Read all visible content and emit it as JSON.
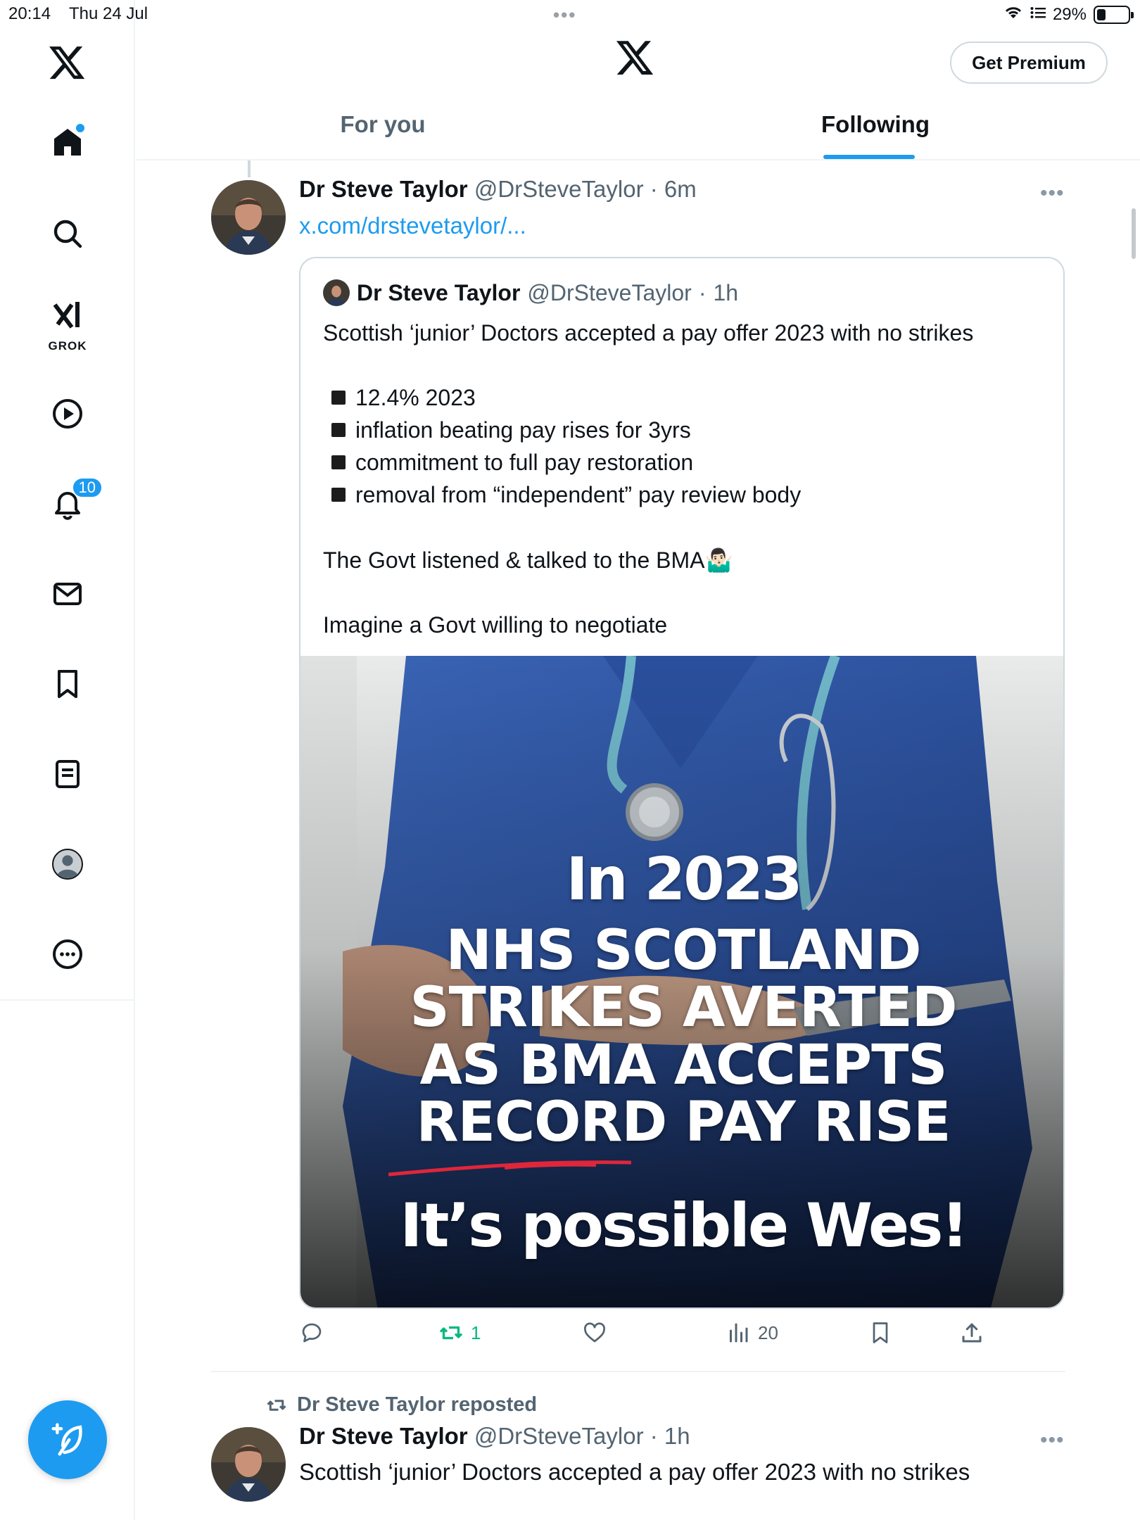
{
  "status_bar": {
    "time": "20:14",
    "date": "Thu 24 Jul",
    "battery": "29%",
    "battery_level": 0.29
  },
  "nav": {
    "notifications_badge": "10",
    "grok_label": "GROK",
    "items": [
      "home-icon",
      "search-icon",
      "grok-icon",
      "video-icon",
      "bell-icon",
      "mail-icon",
      "bookmark-icon",
      "list-icon",
      "profile-icon",
      "more-icon"
    ]
  },
  "header": {
    "premium_label": "Get Premium",
    "tabs": [
      {
        "label": "For you",
        "active": false
      },
      {
        "label": "Following",
        "active": true
      }
    ]
  },
  "tweet": {
    "author": "Dr Steve Taylor",
    "handle": "@DrSteveTaylor",
    "sep": "·",
    "time": "6m",
    "link": "x.com/drstevetaylor/...",
    "quote": {
      "author": "Dr Steve Taylor",
      "handle": "@DrSteveTaylor",
      "time": "1h",
      "line1": "Scottish ‘junior’ Doctors accepted a pay offer 2023 with no strikes",
      "bullets": [
        "12.4% 2023",
        "inflation beating pay rises for 3yrs",
        "commitment to full pay restoration",
        "removal from “independent” pay review body"
      ],
      "line2": "The Govt listened & talked to the BMA🤷🏻‍♂️",
      "line3": "Imagine a Govt willing to negotiate",
      "image_text": {
        "l1": "In 2023",
        "l2": "NHS SCOTLAND",
        "l3": "STRIKES AVERTED",
        "l4": "AS BMA ACCEPTS",
        "l5": "RECORD PAY RISE",
        "l6": "It’s possible Wes!"
      }
    },
    "actions": {
      "reposts": "1",
      "views": "20"
    }
  },
  "tweet2": {
    "repost_label": "Dr Steve Taylor reposted",
    "author": "Dr Steve Taylor",
    "handle": "@DrSteveTaylor",
    "time": "1h",
    "text": "Scottish ‘junior’ Doctors accepted a pay offer 2023 with no strikes"
  },
  "colors": {
    "accent": "#1d9bf0",
    "repost_green": "#00ba7c",
    "text_secondary": "#536471"
  }
}
